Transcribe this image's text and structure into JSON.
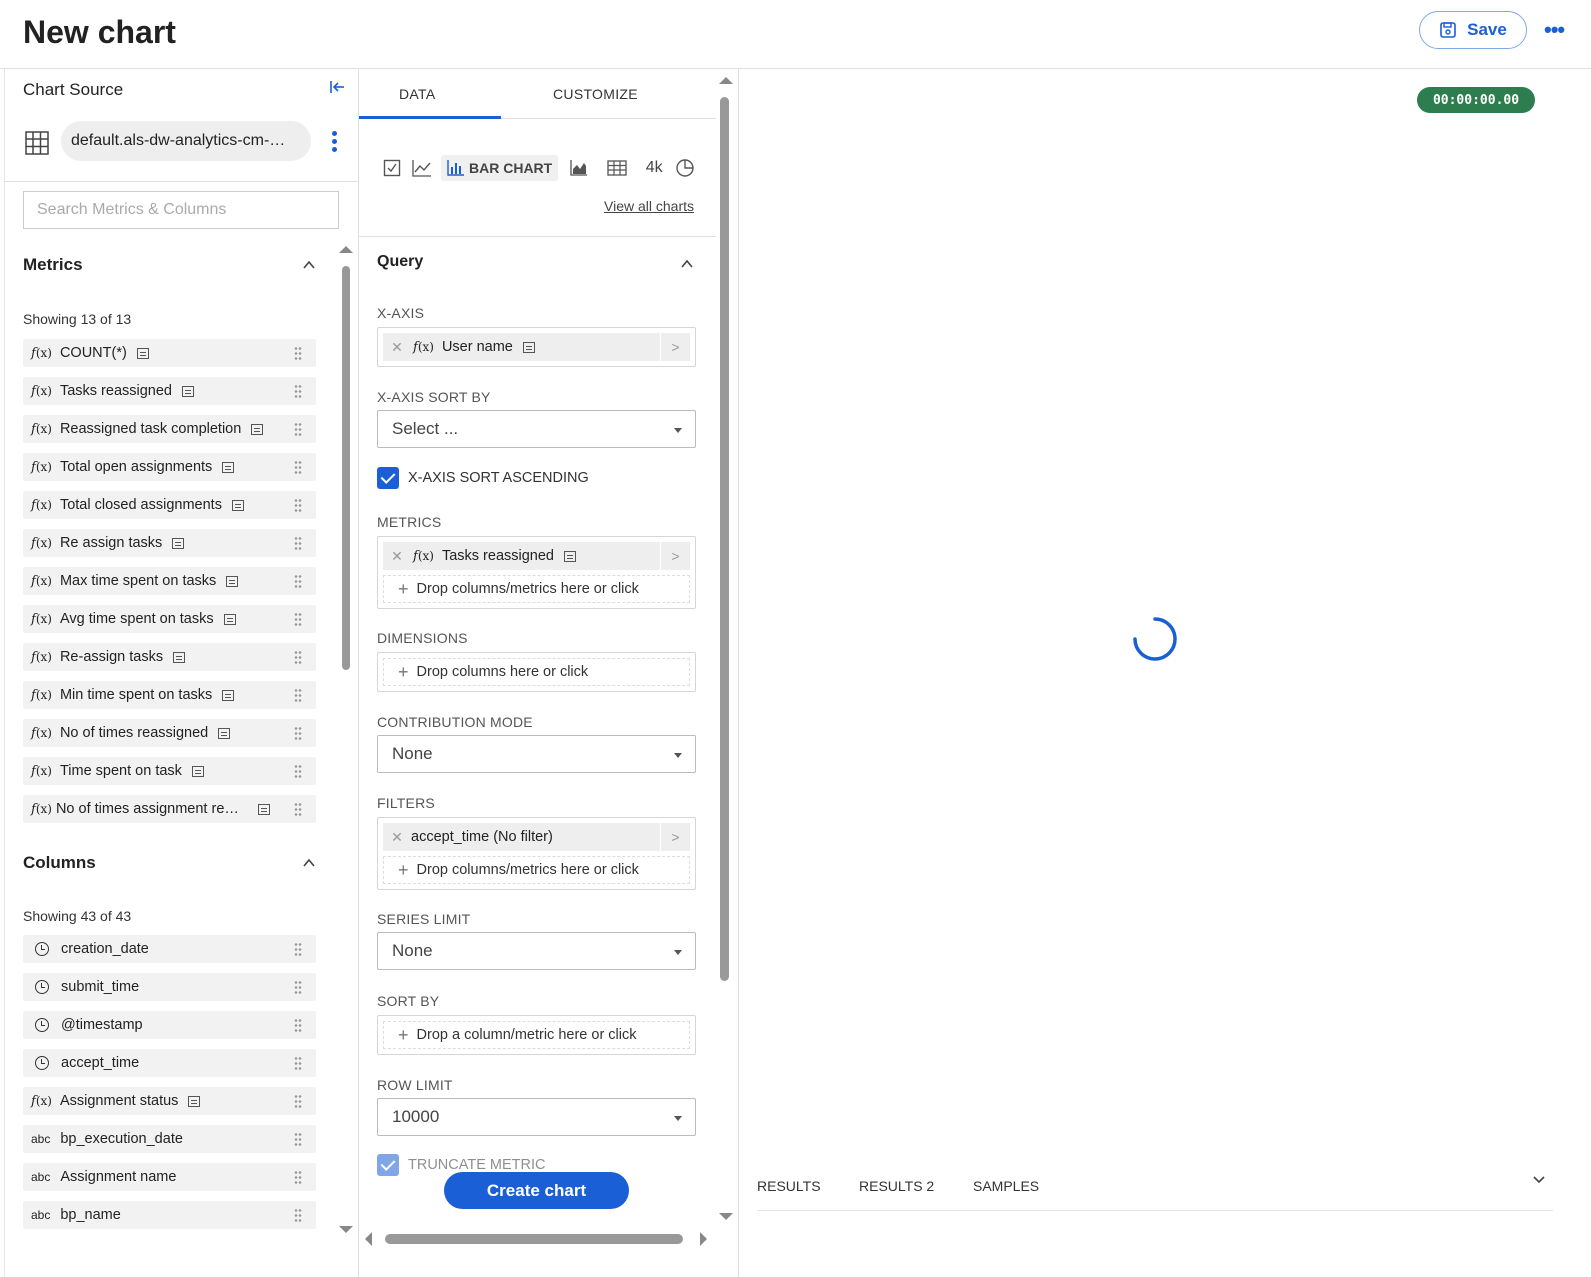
{
  "header": {
    "title": "New chart",
    "save_label": "Save",
    "more_label": "•••"
  },
  "source": {
    "label": "Chart Source",
    "dataset": "default.als-dw-analytics-cm-…",
    "search_placeholder": "Search Metrics & Columns"
  },
  "metrics": {
    "title": "Metrics",
    "showing": "Showing 13 of 13",
    "items": [
      "COUNT(*)",
      "Tasks reassigned",
      "Reassigned task completion",
      "Total open assignments",
      "Total closed assignments",
      "Re assign tasks",
      "Max time spent on tasks",
      "Avg time spent on tasks",
      "Re-assign tasks",
      "Min time spent on tasks",
      "No of times reassigned",
      "Time spent on task",
      "No of times assignment rea…"
    ]
  },
  "columns": {
    "title": "Columns",
    "showing": "Showing 43 of 43",
    "items": [
      {
        "type": "time",
        "label": "creation_date"
      },
      {
        "type": "time",
        "label": "submit_time"
      },
      {
        "type": "time",
        "label": "@timestamp"
      },
      {
        "type": "time",
        "label": "accept_time"
      },
      {
        "type": "fx",
        "label": "Assignment status"
      },
      {
        "type": "abc",
        "label": "bp_execution_date"
      },
      {
        "type": "abc",
        "label": "Assignment name"
      },
      {
        "type": "abc",
        "label": "bp_name"
      }
    ]
  },
  "tabs": {
    "data": "DATA",
    "customize": "CUSTOMIZE"
  },
  "viz": {
    "bar_chart": "BAR CHART",
    "big_number": "4k",
    "view_all": "View all charts"
  },
  "query": {
    "title": "Query",
    "x_axis": {
      "label": "X-AXIS",
      "value": "User name"
    },
    "x_axis_sort_by": {
      "label": "X-AXIS SORT BY",
      "placeholder": "Select ..."
    },
    "x_axis_sort_ascending": {
      "label": "X-AXIS SORT ASCENDING",
      "checked": true
    },
    "metrics": {
      "label": "METRICS",
      "value": "Tasks reassigned",
      "drop": "Drop columns/metrics here or click"
    },
    "dimensions": {
      "label": "DIMENSIONS",
      "drop": "Drop columns here or click"
    },
    "contribution_mode": {
      "label": "CONTRIBUTION MODE",
      "value": "None"
    },
    "filters": {
      "label": "FILTERS",
      "value": "accept_time (No filter)",
      "drop": "Drop columns/metrics here or click"
    },
    "series_limit": {
      "label": "SERIES LIMIT",
      "value": "None"
    },
    "sort_by": {
      "label": "SORT BY",
      "drop": "Drop a column/metric here or click"
    },
    "row_limit": {
      "label": "ROW LIMIT",
      "value": "10000"
    },
    "truncate_metric": {
      "label": "TRUNCATE METRIC",
      "checked": true
    }
  },
  "create_button": "Create chart",
  "timer": "00:00:00.00",
  "results_tabs": [
    "RESULTS",
    "RESULTS 2",
    "SAMPLES"
  ],
  "colors": {
    "accent": "#1a5fd6",
    "timer": "#2e7d4f"
  }
}
